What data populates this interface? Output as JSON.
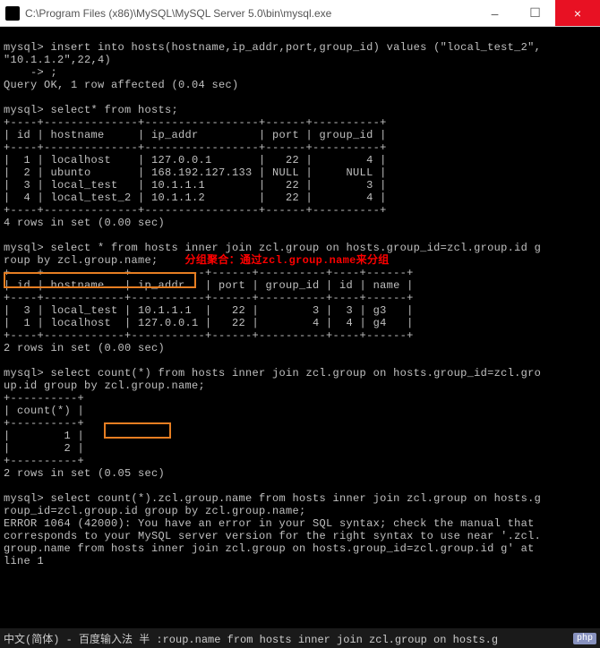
{
  "titlebar": {
    "title": "C:\\Program Files (x86)\\MySQL\\MySQL Server 5.0\\bin\\mysql.exe"
  },
  "win_buttons": {
    "min": "–",
    "max": "☐",
    "close": "×"
  },
  "terminal_lines": {
    "l1": "mysql> insert into hosts(hostname,ip_addr,port,group_id) values (\"local_test_2\",",
    "l2": "\"10.1.1.2\",22,4)",
    "l3": "    -> ;",
    "l4": "Query OK, 1 row affected (0.04 sec)",
    "l5": "",
    "l6": "mysql> select* from hosts;",
    "l7": "+----+--------------+-----------------+------+----------+",
    "l8": "| id | hostname     | ip_addr         | port | group_id |",
    "l9": "+----+--------------+-----------------+------+----------+",
    "l10": "|  1 | localhost    | 127.0.0.1       |   22 |        4 |",
    "l11": "|  2 | ubunto       | 168.192.127.133 | NULL |     NULL |",
    "l12": "|  3 | local_test   | 10.1.1.1        |   22 |        3 |",
    "l13": "|  4 | local_test_2 | 10.1.1.2        |   22 |        4 |",
    "l14": "+----+--------------+-----------------+------+----------+",
    "l15": "4 rows in set (0.00 sec)",
    "l16": "",
    "l17": "mysql> select * from hosts inner join zcl.group on hosts.group_id=zcl.group.id g",
    "l18": "roup by zcl.group.name;",
    "annotation": "    分组聚合：通过zcl.group.name来分组",
    "l19": "+----+------------+-----------+------+----------+----+------+",
    "l20": "| id | hostname   | ip_addr   | port | group_id | id | name |",
    "l21": "+----+------------+-----------+------+----------+----+------+",
    "l22": "|  3 | local_test | 10.1.1.1  |   22 |        3 |  3 | g3   |",
    "l23": "|  1 | localhost  | 127.0.0.1 |   22 |        4 |  4 | g4   |",
    "l24": "+----+------------+-----------+------+----------+----+------+",
    "l25": "2 rows in set (0.00 sec)",
    "l26": "",
    "l27": "mysql> select count(*) from hosts inner join zcl.group on hosts.group_id=zcl.gro",
    "l28": "up.id group by zcl.group.name;",
    "l29": "+----------+",
    "l30": "| count(*) |",
    "l31": "+----------+",
    "l32": "|        1 |",
    "l33": "|        2 |",
    "l34": "+----------+",
    "l35": "2 rows in set (0.05 sec)",
    "l36": "",
    "l37": "mysql> select count(*).zcl.group.name from hosts inner join zcl.group on hosts.g",
    "l38": "roup_id=zcl.group.id group by zcl.group.name;",
    "l39": "ERROR 1064 (42000): You have an error in your SQL syntax; check the manual that",
    "l40": "corresponds to your MySQL server version for the right syntax to use near '.zcl.",
    "l41": "group.name from hosts inner join zcl.group on hosts.group_id=zcl.group.id g' at",
    "l42": "line 1"
  },
  "statusbar": {
    "left": "中文(简体) - 百度输入法 半 :roup.name from hosts inner join zcl.group on hosts.g",
    "badge": "php"
  }
}
